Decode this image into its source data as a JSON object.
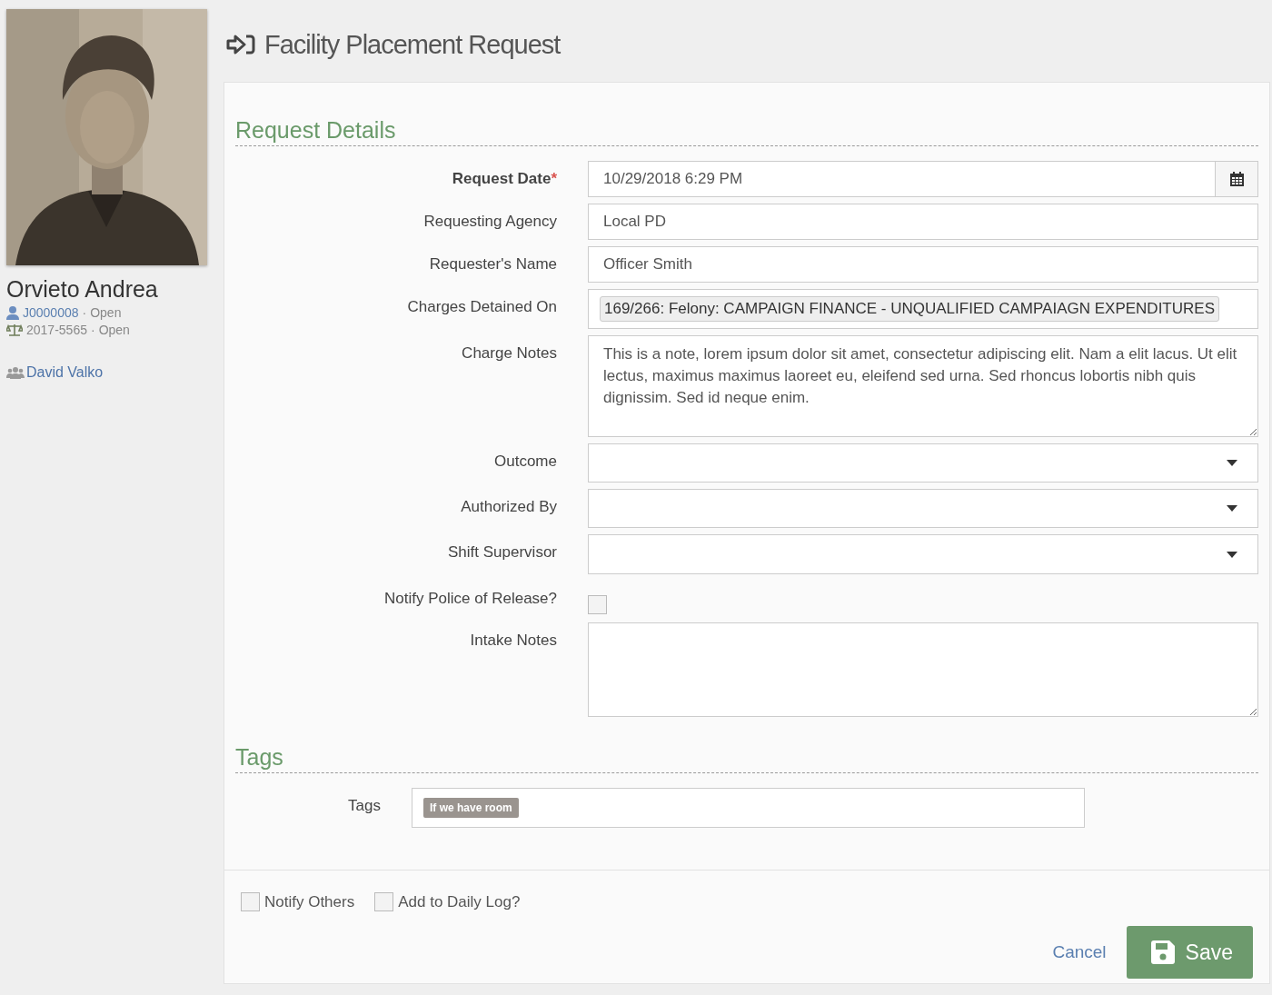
{
  "person": {
    "name": "Orvieto Andrea",
    "records": [
      {
        "kind": "juvenile",
        "id": "J0000008",
        "separator": "·",
        "status": "Open"
      },
      {
        "kind": "case",
        "id": "2017-5565",
        "separator": "·",
        "status": "Open"
      }
    ],
    "worker": "David Valko"
  },
  "page": {
    "title": "Facility Placement Request"
  },
  "sections": [
    {
      "title": "Request Details",
      "fields": [
        {
          "kind": "datetime",
          "label": "Request Date",
          "required": true,
          "required_mark": "*",
          "value": "10/29/2018 6:29 PM"
        },
        {
          "kind": "text",
          "label": "Requesting Agency",
          "required": false,
          "value": "Local PD"
        },
        {
          "kind": "text",
          "label": "Requester's Name",
          "required": false,
          "value": "Officer Smith"
        },
        {
          "kind": "chips",
          "label": "Charges Detained On",
          "required": false,
          "chips": [
            "169/266: Felony: CAMPAIGN FINANCE - UNQUALIFIED CAMPAIAGN EXPENDITURES"
          ]
        },
        {
          "kind": "textarea",
          "label": "Charge Notes",
          "required": false,
          "value": "This is a note, lorem ipsum dolor sit amet, consectetur adipiscing elit. Nam a elit lacus. Ut elit lectus, maximus maximus laoreet eu, eleifend sed urna. Sed rhoncus lobortis nibh quis dignissim. Sed id neque enim."
        },
        {
          "kind": "select",
          "label": "Outcome",
          "required": false
        },
        {
          "kind": "select",
          "label": "Authorized By",
          "required": false
        },
        {
          "kind": "select",
          "label": "Shift Supervisor",
          "required": false
        },
        {
          "kind": "checkbox",
          "label": "Notify Police of Release?",
          "required": false,
          "checked": false
        },
        {
          "kind": "textarea",
          "label": "Intake Notes",
          "required": false
        }
      ]
    },
    {
      "title": "Tags",
      "fields": [
        {
          "kind": "tags",
          "label": "Tags",
          "required": false,
          "chips": [
            "If we have room"
          ]
        }
      ]
    }
  ],
  "options": [
    {
      "label": "Notify Others",
      "checked": false
    },
    {
      "label": "Add to Daily Log?",
      "checked": false
    }
  ],
  "actions": {
    "cancel": "Cancel",
    "save": "Save"
  }
}
